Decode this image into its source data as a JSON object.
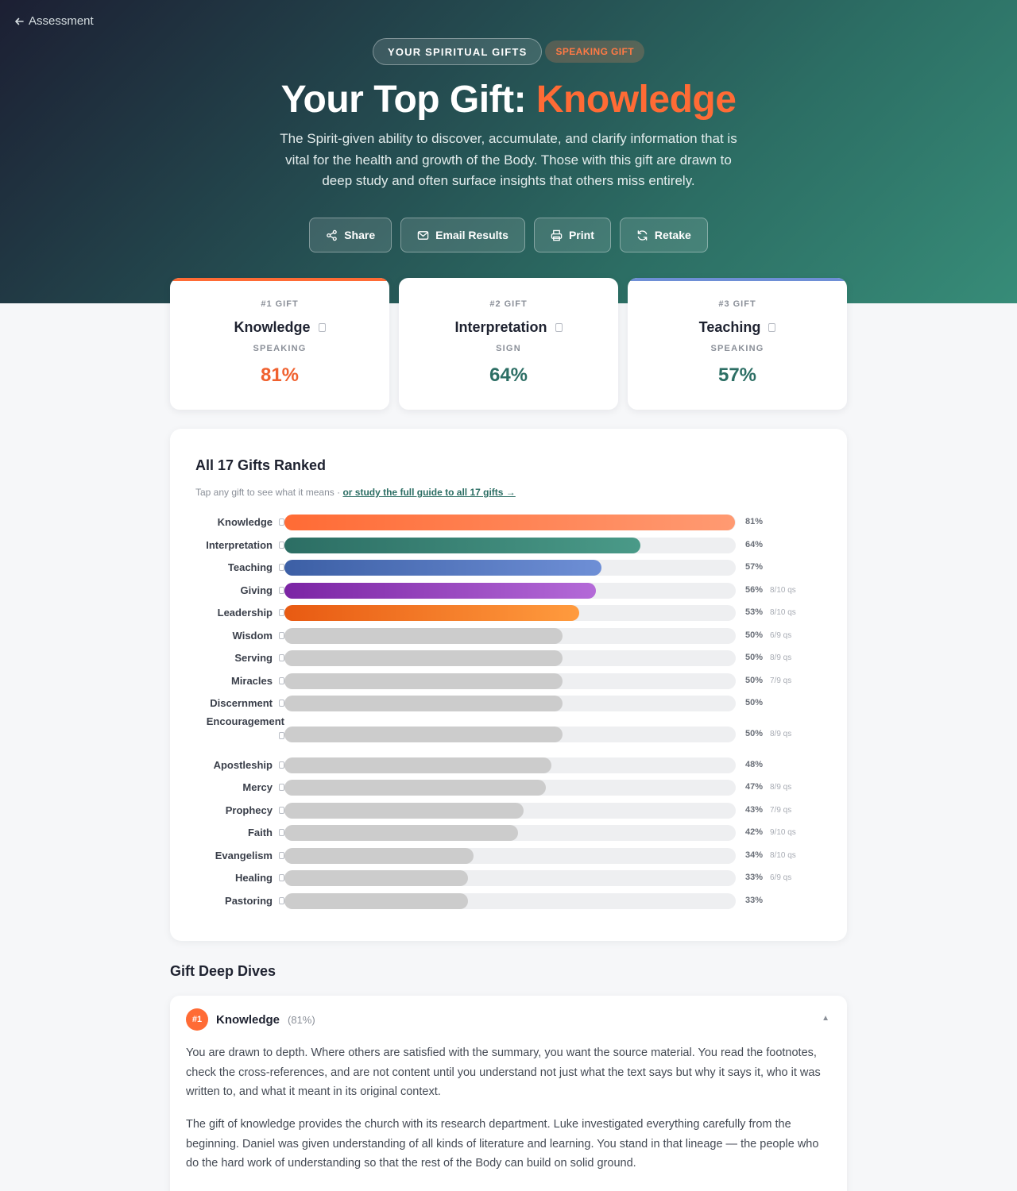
{
  "nav": {
    "back_label": "Assessment"
  },
  "hero": {
    "pill_label": "YOUR SPIRITUAL GIFTS",
    "pill_sub": "SPEAKING GIFT",
    "title_prefix": "Your Top Gift: ",
    "title_gift": "Knowledge",
    "description": "The Spirit-given ability to discover, accumulate, and clarify information that is vital for the health and growth of the Body. Those with this gift are drawn to deep study and often surface insights that others miss entirely."
  },
  "actions": [
    {
      "label": "Share",
      "icon": "share-icon"
    },
    {
      "label": "Email Results",
      "icon": "mail-icon"
    },
    {
      "label": "Print",
      "icon": "printer-icon"
    },
    {
      "label": "Retake",
      "icon": "refresh-icon"
    }
  ],
  "top_gifts": [
    {
      "rank": "#1 GIFT",
      "name": "Knowledge",
      "category": "SPEAKING",
      "pct": "81%",
      "color": "#ff6b35",
      "pct_color": "#f0612f"
    },
    {
      "rank": "#2 GIFT",
      "name": "Interpretation",
      "category": "SIGN",
      "pct": "64%",
      "color": "#ffffff",
      "pct_color": "#2c6e64"
    },
    {
      "rank": "#3 GIFT",
      "name": "Teaching",
      "category": "SPEAKING",
      "pct": "57%",
      "color": "#6e8fd6",
      "pct_color": "#2c6e64"
    }
  ],
  "ranked": {
    "title": "All 17 Gifts Ranked",
    "hint": "Tap any gift to see what it means · ",
    "guide_link": "or study the full guide to all 17 gifts →",
    "gifts": [
      {
        "name": "Knowledge",
        "value": 81,
        "pct": "81%",
        "qs": "",
        "gradient": [
          "#ff6b35",
          "#ff9a72"
        ]
      },
      {
        "name": "Interpretation",
        "value": 64,
        "pct": "64%",
        "qs": "",
        "gradient": [
          "#2c6e64",
          "#4a9a88"
        ]
      },
      {
        "name": "Teaching",
        "value": 57,
        "pct": "57%",
        "qs": "",
        "gradient": [
          "#3c5fa5",
          "#6e8fd6"
        ]
      },
      {
        "name": "Giving",
        "value": 56,
        "pct": "56%",
        "qs": "8/10 qs",
        "gradient": [
          "#7b24a4",
          "#b46ad8"
        ]
      },
      {
        "name": "Leadership",
        "value": 53,
        "pct": "53%",
        "qs": "8/10 qs",
        "gradient": [
          "#e85a12",
          "#ff9b3e"
        ]
      },
      {
        "name": "Wisdom",
        "value": 50,
        "pct": "50%",
        "qs": "6/9 qs",
        "gradient": [
          "#cccccc",
          "#cccccc"
        ]
      },
      {
        "name": "Serving",
        "value": 50,
        "pct": "50%",
        "qs": "8/9 qs",
        "gradient": [
          "#cccccc",
          "#cccccc"
        ]
      },
      {
        "name": "Miracles",
        "value": 50,
        "pct": "50%",
        "qs": "7/9 qs",
        "gradient": [
          "#cccccc",
          "#cccccc"
        ]
      },
      {
        "name": "Discernment",
        "value": 50,
        "pct": "50%",
        "qs": "",
        "gradient": [
          "#cccccc",
          "#cccccc"
        ]
      },
      {
        "name": "Encouragement",
        "value": 50,
        "pct": "50%",
        "qs": "8/9 qs",
        "gradient": [
          "#cccccc",
          "#cccccc"
        ]
      },
      {
        "name": "Apostleship",
        "value": 48,
        "pct": "48%",
        "qs": "",
        "gradient": [
          "#cccccc",
          "#cccccc"
        ]
      },
      {
        "name": "Mercy",
        "value": 47,
        "pct": "47%",
        "qs": "8/9 qs",
        "gradient": [
          "#cccccc",
          "#cccccc"
        ]
      },
      {
        "name": "Prophecy",
        "value": 43,
        "pct": "43%",
        "qs": "7/9 qs",
        "gradient": [
          "#cccccc",
          "#cccccc"
        ]
      },
      {
        "name": "Faith",
        "value": 42,
        "pct": "42%",
        "qs": "9/10 qs",
        "gradient": [
          "#cccccc",
          "#cccccc"
        ]
      },
      {
        "name": "Evangelism",
        "value": 34,
        "pct": "34%",
        "qs": "8/10 qs",
        "gradient": [
          "#cccccc",
          "#cccccc"
        ]
      },
      {
        "name": "Healing",
        "value": 33,
        "pct": "33%",
        "qs": "6/9 qs",
        "gradient": [
          "#cccccc",
          "#cccccc"
        ]
      },
      {
        "name": "Pastoring",
        "value": 33,
        "pct": "33%",
        "qs": "",
        "gradient": [
          "#cccccc",
          "#cccccc"
        ]
      }
    ]
  },
  "deep_dives": {
    "title": "Gift Deep Dives",
    "items": [
      {
        "badge": "#1",
        "name": "Knowledge",
        "pct": "(81%)",
        "paragraphs": [
          "You are drawn to depth. Where others are satisfied with the summary, you want the source material. You read the footnotes, check the cross-references, and are not content until you understand not just what the text says but why it says it, who it was written to, and what it meant in its original context.",
          "The gift of knowledge provides the church with its research department. Luke investigated everything carefully from the beginning. Daniel was given understanding of all kinds of literature and learning. You stand in that lineage — the people who do the hard work of understanding so that the rest of the Body can build on solid ground."
        ]
      }
    ]
  }
}
